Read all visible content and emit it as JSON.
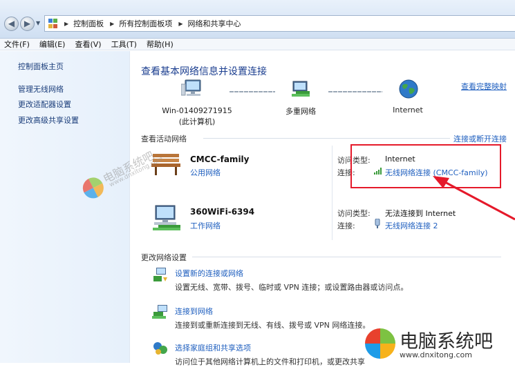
{
  "breadcrumb": [
    "控制面板",
    "所有控制面板项",
    "网络和共享中心"
  ],
  "menu": [
    "文件(F)",
    "编辑(E)",
    "查看(V)",
    "工具(T)",
    "帮助(H)"
  ],
  "sidebar": {
    "home": "控制面板主页",
    "items": [
      "管理无线网络",
      "更改适配器设置",
      "更改高级共享设置"
    ]
  },
  "main": {
    "title": "查看基本网络信息并设置连接",
    "view_full_map": "查看完整映射",
    "map": {
      "computer_name": "Win-01409271915",
      "computer_sub": "(此计算机)",
      "multi": "多重网络",
      "internet": "Internet"
    },
    "active_networks_heading": "查看活动网络",
    "connect_disconnect": "连接或断开连接",
    "networks": [
      {
        "name": "CMCC-family",
        "type": "公用网络",
        "access_type_label": "访问类型:",
        "access_type": "Internet",
        "connection_label": "连接:",
        "connection": "无线网络连接 (CMCC-family)"
      },
      {
        "name": "360WiFi-6394",
        "type": "工作网络",
        "access_type_label": "访问类型:",
        "access_type": "无法连接到 Internet",
        "connection_label": "连接:",
        "connection": "无线网络连接 2"
      }
    ],
    "change_settings_heading": "更改网络设置",
    "tasks": [
      {
        "title": "设置新的连接或网络",
        "desc": "设置无线、宽带、拨号、临时或 VPN 连接；或设置路由器或访问点。",
        "icon": "setup-connection-icon"
      },
      {
        "title": "连接到网络",
        "desc": "连接到或重新连接到无线、有线、拨号或 VPN 网络连接。",
        "icon": "connect-network-icon"
      },
      {
        "title": "选择家庭组和共享选项",
        "desc": "访问位于其他网络计算机上的文件和打印机，或更改共享",
        "icon": "homegroup-icon"
      }
    ]
  },
  "watermark": {
    "text": "电脑系统吧",
    "url": "www.dnxitong.com"
  },
  "colors": {
    "link": "#1f5fbf",
    "highlight": "#e5192a",
    "title": "#1a3d8f"
  }
}
